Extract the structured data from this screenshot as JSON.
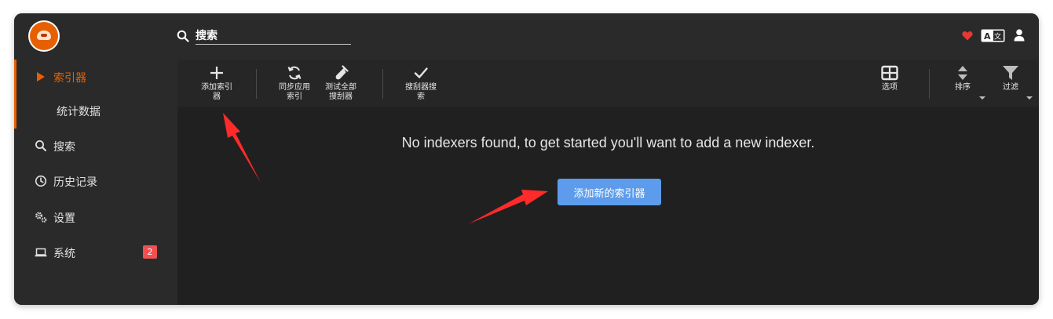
{
  "header": {
    "search_placeholder": "搜索",
    "icons": [
      "heart-icon",
      "translate-icon",
      "user-icon"
    ],
    "heart_color": "#e53935"
  },
  "sidebar": {
    "items": [
      {
        "label": "索引器",
        "icon": "play-icon",
        "active": true
      },
      {
        "label": "统计数据",
        "icon": "",
        "active": false
      },
      {
        "label": "搜索",
        "icon": "search-icon",
        "active": false
      },
      {
        "label": "历史记录",
        "icon": "clock-icon",
        "active": false
      },
      {
        "label": "设置",
        "icon": "cogs-icon",
        "active": false
      },
      {
        "label": "系统",
        "icon": "laptop-icon",
        "active": false,
        "badge": "2"
      }
    ]
  },
  "toolbar": {
    "add_indexer": "添加索引器",
    "sync_app_indexers": "同步应用索引",
    "test_all_indexers": "测试全部搜刮器",
    "manual_search": "搜刮器搜索",
    "options": "选项",
    "sort": "排序",
    "filter": "过滤"
  },
  "content": {
    "empty_message": "No indexers found, to get started you'll want to add a new indexer.",
    "add_new_indexer_button": "添加新的索引器"
  },
  "colors": {
    "accent": "#e66001",
    "primary_button": "#5d9cec",
    "badge": "#f05050",
    "annotation_arrow": "#ff2a2a"
  }
}
